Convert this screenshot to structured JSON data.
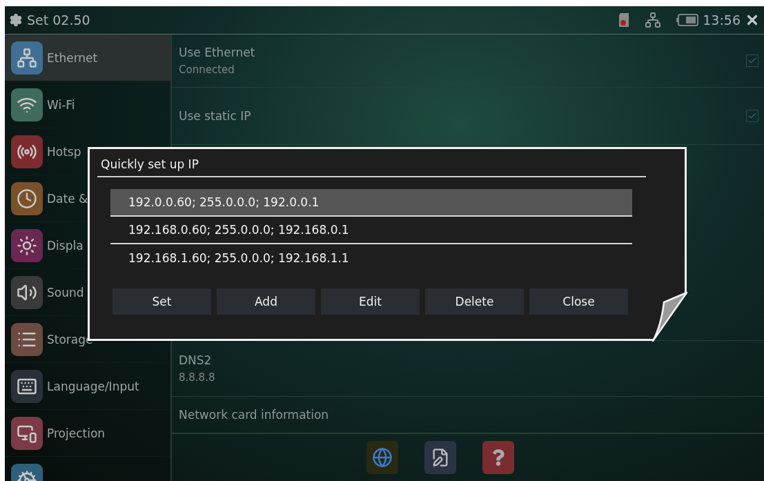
{
  "header": {
    "title": "Set 02.50",
    "time": "13:56"
  },
  "sidebar": {
    "items": [
      {
        "kind": "ethernet",
        "label": "Ethernet",
        "selected": true,
        "color": "#3f6f94"
      },
      {
        "kind": "wifi",
        "label": "Wi-Fi",
        "selected": false,
        "color": "#3f6b5c"
      },
      {
        "kind": "hotspot",
        "label": "Hotsp",
        "selected": false,
        "color": "#7d2b2e"
      },
      {
        "kind": "clock",
        "label": "Date &",
        "selected": false,
        "color": "#7a5128"
      },
      {
        "kind": "display",
        "label": "Displa",
        "selected": false,
        "color": "#6a2752"
      },
      {
        "kind": "sound",
        "label": "Sound",
        "selected": false,
        "color": "#3a3a3a"
      },
      {
        "kind": "storage",
        "label": "Storage",
        "selected": false,
        "color": "#6b4a40"
      },
      {
        "kind": "language",
        "label": "Language/Input",
        "selected": false,
        "color": "#2a3038"
      },
      {
        "kind": "projection",
        "label": "Projection",
        "selected": false,
        "color": "#7b3a46"
      },
      {
        "kind": "system",
        "selected": false,
        "color": "#2f5f7a"
      }
    ]
  },
  "settings": [
    {
      "kind": "check",
      "title": "Use Ethernet",
      "subtitle": "Connected",
      "checked": true
    },
    {
      "kind": "check",
      "title": "Use static IP",
      "checked": true
    },
    {
      "kind": "hidden"
    },
    {
      "kind": "info",
      "title": "DNS2",
      "subtitle": "8.8.8.8"
    },
    {
      "kind": "info",
      "title": "Network card information"
    }
  ],
  "dialog": {
    "title": "Quickly set up IP",
    "entries": [
      {
        "text": "192.0.0.60; 255.0.0.0; 192.0.0.1",
        "selected": true
      },
      {
        "text": "192.168.0.60; 255.0.0.0; 192.168.0.1",
        "selected": false
      },
      {
        "text": "192.168.1.60; 255.0.0.0; 192.168.1.1",
        "selected": false
      }
    ],
    "buttons": [
      "Set",
      "Add",
      "Edit",
      "Delete",
      "Close"
    ]
  },
  "toolbar": [
    {
      "kind": "remote"
    },
    {
      "kind": "note"
    },
    {
      "kind": "help"
    }
  ]
}
